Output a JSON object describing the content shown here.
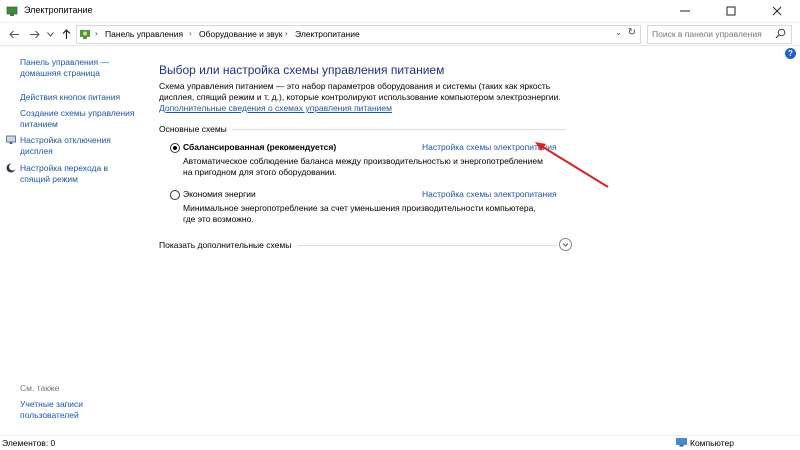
{
  "window": {
    "title": "Электропитание",
    "minimize_icon": "minimize-icon",
    "maximize_icon": "maximize-icon",
    "close_icon": "close-icon"
  },
  "address": {
    "breadcrumbs": [
      "Панель управления",
      "Оборудование и звук",
      "Электропитание"
    ],
    "search_placeholder": "Поиск в панели управления"
  },
  "sidebar": {
    "items": [
      {
        "label_lines": [
          "Панель управления —",
          "домашняя страница"
        ]
      },
      {
        "label_lines": [
          "Действия кнопок питания"
        ]
      },
      {
        "label_lines": [
          "Создание схемы управления",
          "питанием"
        ]
      },
      {
        "label_lines": [
          "Настройка отключения",
          "дисплея"
        ]
      },
      {
        "label_lines": [
          "Настройка перехода в",
          "спящий режим"
        ]
      }
    ],
    "see_also": "См. также",
    "see_also_items": [
      {
        "label_lines": [
          "Учетные записи",
          "пользователей"
        ]
      }
    ]
  },
  "main": {
    "heading": "Выбор или настройка схемы управления питанием",
    "description_lines": [
      "Схема управления питанием — это набор параметров оборудования и системы (таких как яркость",
      "дисплея, спящий режим и т. д.), которые контролируют использование компьютером электроэнергии."
    ],
    "details_link": "Дополнительные сведения о схемах управления питанием",
    "group_label": "Основные схемы",
    "plans": [
      {
        "name": "Сбалансированная (рекомендуется)",
        "selected": true,
        "link": "Настройка схемы электропитания",
        "description_lines": [
          "Автоматическое соблюдение баланса между производительностью и энергопотреблением",
          "на пригодном для этого оборудовании."
        ]
      },
      {
        "name": "Экономия энергии",
        "selected": false,
        "link": "Настройка схемы электропитания",
        "description_lines": [
          "Минимальное энергопотребление за счет уменьшения производительности компьютера,",
          "где это возможно."
        ]
      }
    ],
    "more_plans": "Показать дополнительные схемы"
  },
  "status": {
    "items_count": "Элементов: 0",
    "location": "Компьютер"
  },
  "colors": {
    "link": "#1a56b0",
    "heading": "#1e3287",
    "annotation_arrow": "#e02020"
  }
}
